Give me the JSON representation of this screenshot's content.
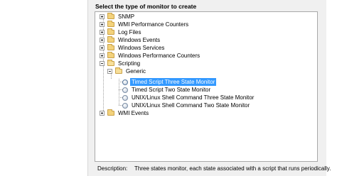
{
  "heading": "Select the type of monitor to create",
  "tree": {
    "items": [
      {
        "label": "SNMP"
      },
      {
        "label": "WMI Performance Counters"
      },
      {
        "label": "Log Files"
      },
      {
        "label": "Windows Events"
      },
      {
        "label": "Windows Services"
      },
      {
        "label": "Windows Performance Counters"
      },
      {
        "label": "Scripting"
      },
      {
        "label": "Generic"
      },
      {
        "label": "Timed Script Three State Monitor",
        "selected": true
      },
      {
        "label": "Timed Script Two State Monitor"
      },
      {
        "label": "UNIX/Linux Shell Command Three State Monitor"
      },
      {
        "label": "UNIX/Linux Shell Command Two State Monitor"
      },
      {
        "label": "WMI Events"
      }
    ]
  },
  "description": {
    "label": "Description:",
    "text": "Three states monitor, each state associated with a script that runs periodically."
  },
  "colors": {
    "selection": "#3399ff",
    "panel": "#f0f0f0",
    "folder": "#f3d27c"
  },
  "icons": {
    "folder": "folder-icon",
    "monitor": "monitor-type-icon",
    "expand": "expand-plus-icon",
    "collapse": "collapse-minus-icon"
  }
}
